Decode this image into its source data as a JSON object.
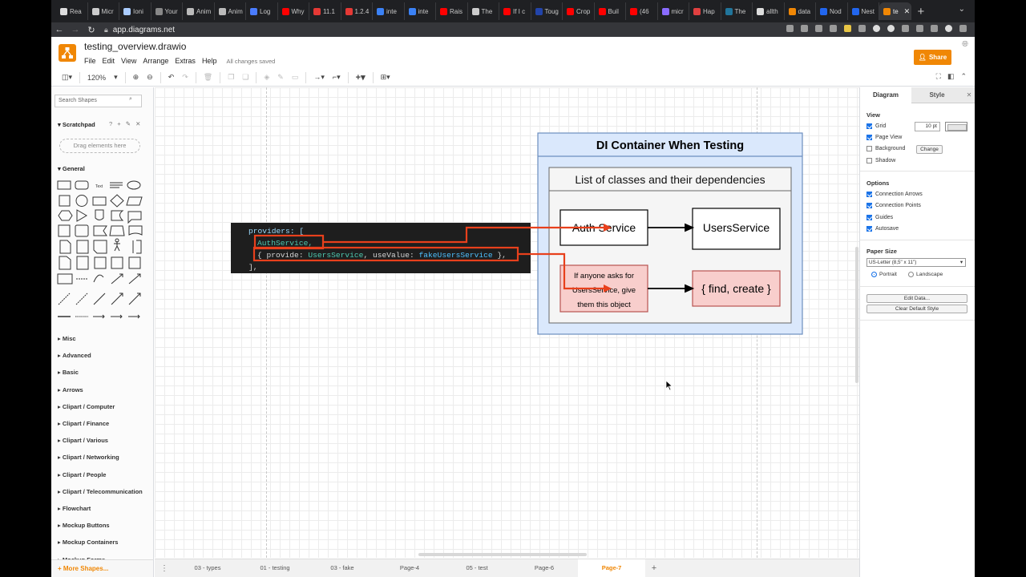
{
  "browser": {
    "tabs": [
      {
        "label": "Rea",
        "color": "#dddddd"
      },
      {
        "label": "Micr",
        "color": "#cccccc"
      },
      {
        "label": "Ioni",
        "color": "#aaccff"
      },
      {
        "label": "Your",
        "color": "#888888"
      },
      {
        "label": "Anim",
        "color": "#bbbbbb"
      },
      {
        "label": "Anim",
        "color": "#bbbbbb"
      },
      {
        "label": "Log",
        "color": "#4a7cff"
      },
      {
        "label": "Why",
        "color": "#ff0000"
      },
      {
        "label": "11.1",
        "color": "#e53935"
      },
      {
        "label": "1.2.4",
        "color": "#e53935"
      },
      {
        "label": "inte",
        "color": "#3b82f6"
      },
      {
        "label": "inte",
        "color": "#3b82f6"
      },
      {
        "label": "Rais",
        "color": "#ff0000"
      },
      {
        "label": "The",
        "color": "#cccccc"
      },
      {
        "label": "If I c",
        "color": "#ff0000"
      },
      {
        "label": "Toug",
        "color": "#2244aa"
      },
      {
        "label": "Crop",
        "color": "#ff0000"
      },
      {
        "label": "Buil",
        "color": "#ff0000"
      },
      {
        "label": "(46",
        "color": "#ff0000"
      },
      {
        "label": "micr",
        "color": "#8a6cff"
      },
      {
        "label": "Hap",
        "color": "#e04040"
      },
      {
        "label": "The",
        "color": "#21759b"
      },
      {
        "label": "allth",
        "color": "#dddddd"
      },
      {
        "label": "data",
        "color": "#f08705"
      },
      {
        "label": "Nod",
        "color": "#2266ee"
      },
      {
        "label": "Nest",
        "color": "#2266ee"
      },
      {
        "label": "te",
        "color": "#f08705",
        "active": true
      }
    ],
    "url": "app.diagrams.net"
  },
  "app": {
    "doc_title": "testing_overview.drawio",
    "menu": [
      "File",
      "Edit",
      "View",
      "Arrange",
      "Extras",
      "Help"
    ],
    "save_status": "All changes saved",
    "share_label": "Share",
    "zoom": "120%",
    "brand_color": "#f08705"
  },
  "left_panel": {
    "search_placeholder": "Search Shapes",
    "scratchpad_title": "Scratchpad",
    "scratchpad_tools": "? + ✎ ✕",
    "dropzone_label": "Drag elements here",
    "general_title": "General",
    "categories": [
      "Misc",
      "Advanced",
      "Basic",
      "Arrows",
      "Clipart / Computer",
      "Clipart / Finance",
      "Clipart / Various",
      "Clipart / Networking",
      "Clipart / People",
      "Clipart / Telecommunication",
      "Flowchart",
      "Mockup Buttons",
      "Mockup Containers",
      "Mockup Forms"
    ],
    "more_shapes": "+ More Shapes..."
  },
  "diagram": {
    "container_title": "DI Container When Testing",
    "inner_title": "List of classes and their dependencies",
    "auth_service": "Auth Service",
    "users_service": "UsersService",
    "if_anyone_asks": [
      "If anyone asks for",
      "UsersService, give",
      "them this object"
    ],
    "find_create": "{ find, create }",
    "code_line1": "providers: [",
    "code_auth": "AuthService,",
    "code_provide_open": "{ provide: ",
    "code_users_service": "UsersService",
    "code_use_value": ", useValue: ",
    "code_fake": "fakeUsersService",
    "code_provide_close": " },",
    "code_line4": "],",
    "colors": {
      "container_fill": "#dae8fc",
      "container_border": "#6c8ebf",
      "pink_fill": "#f8cecc",
      "pink_border": "#b85450",
      "arrow_red": "#e8401c"
    }
  },
  "pages": {
    "tabs": [
      "03 - types",
      "01 - testing",
      "03 - fake",
      "Page-4",
      "05 - test",
      "Page-6",
      "Page-7"
    ],
    "active": "Page-7"
  },
  "right_panel": {
    "tab_diagram": "Diagram",
    "tab_style": "Style",
    "view_title": "View",
    "grid": "Grid",
    "grid_size": "10 pt",
    "page_view": "Page View",
    "background": "Background",
    "change": "Change",
    "shadow": "Shadow",
    "options_title": "Options",
    "connection_arrows": "Connection Arrows",
    "connection_points": "Connection Points",
    "guides": "Guides",
    "autosave": "Autosave",
    "paper_size_title": "Paper Size",
    "paper_size_value": "US-Letter (8,5\" x 11\")",
    "portrait": "Portrait",
    "landscape": "Landscape",
    "edit_data": "Edit Data...",
    "clear_default_style": "Clear Default Style"
  }
}
